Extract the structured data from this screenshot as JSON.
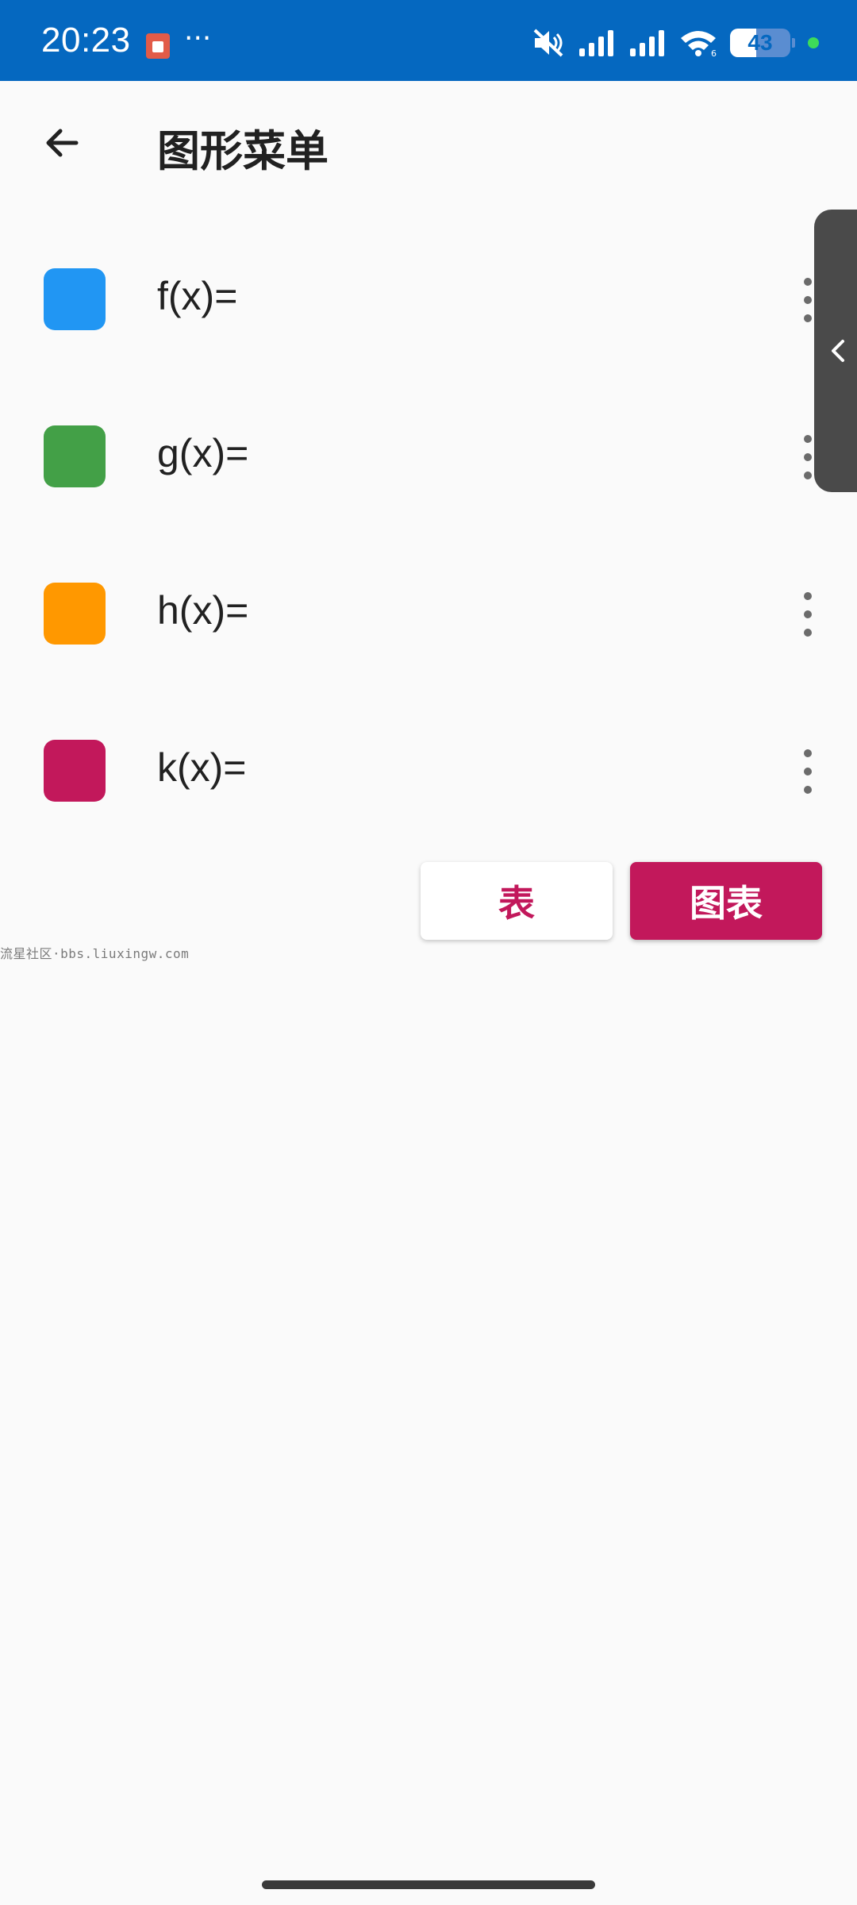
{
  "status_bar": {
    "time": "20:23",
    "more": "···",
    "battery_level": "43",
    "battery_fraction": 0.43,
    "colors": {
      "background": "#0568c0",
      "dot": "#3ddc5a"
    },
    "icons": [
      "notification-app-icon",
      "mute-icon",
      "signal-icon",
      "signal-icon",
      "wifi-icon",
      "battery-icon"
    ]
  },
  "app_bar": {
    "back_icon": "arrow-left-icon",
    "title": "图形菜单"
  },
  "functions": [
    {
      "label": "f(x)=",
      "color": "#2196f3"
    },
    {
      "label": "g(x)=",
      "color": "#43a047"
    },
    {
      "label": "h(x)=",
      "color": "#ff9800"
    },
    {
      "label": "k(x)=",
      "color": "#c2185b"
    }
  ],
  "edge_panel": {
    "icon": "chevron-left-icon"
  },
  "buttons": {
    "table_label": "表",
    "graph_label": "图表",
    "accent": "#c2185b"
  },
  "watermark": "流星社区·bbs.liuxingw.com"
}
